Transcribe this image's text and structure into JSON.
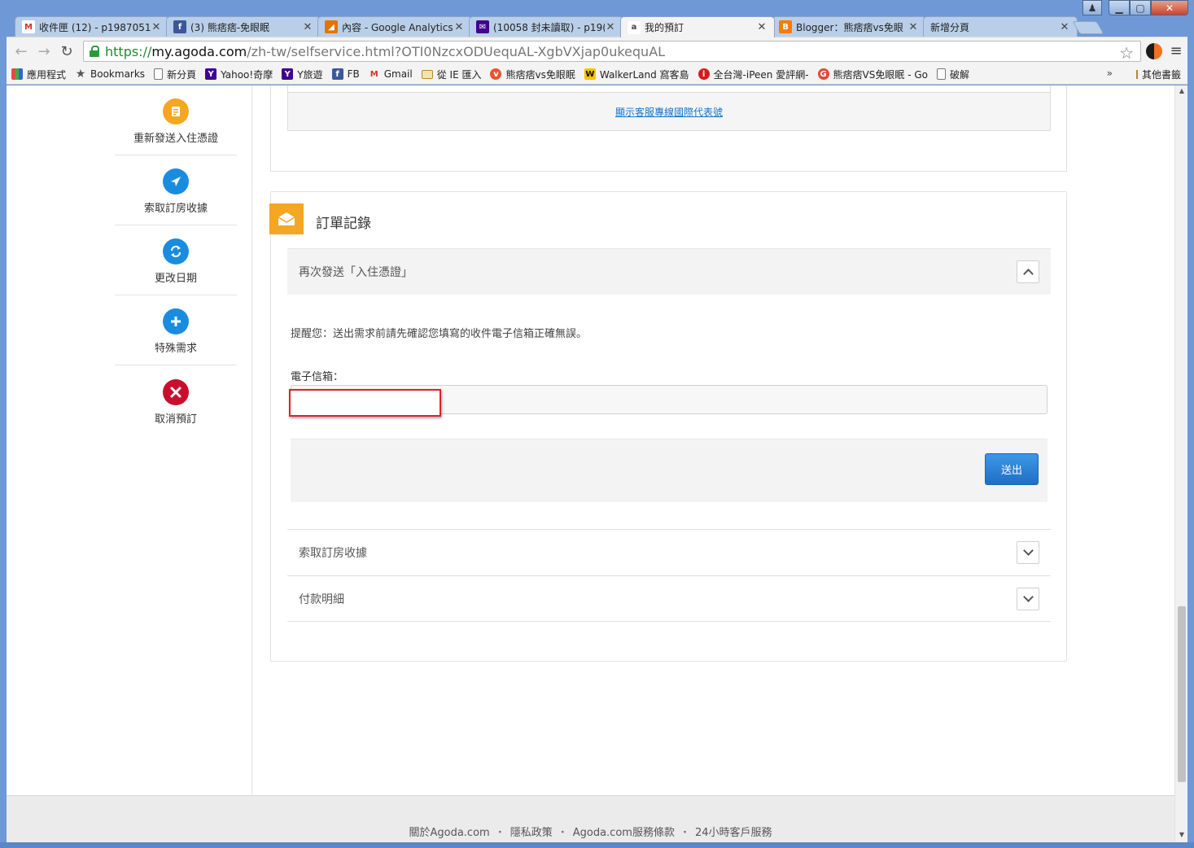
{
  "browser": {
    "tabs": [
      {
        "title": "收件匣 (12) - p1987051",
        "icon": "gmail-icon",
        "color": "#d93025"
      },
      {
        "title": "(3) 熊痞痞-免眼眠",
        "icon": "facebook-icon",
        "color": "#3b5998"
      },
      {
        "title": "內容 - Google Analytics",
        "icon": "analytics-icon",
        "color": "#e37400"
      },
      {
        "title": "(10058 封未讀取) - p19(",
        "icon": "yahoo-mail-icon",
        "color": "#400090"
      },
      {
        "title": "我的預訂",
        "icon": "agoda-icon",
        "color": "#444444"
      },
      {
        "title": "Blogger：熊痞痞vs免眼",
        "icon": "blogger-icon",
        "color": "#f57d00"
      },
      {
        "title": "新增分頁",
        "icon": "",
        "color": ""
      }
    ],
    "url": {
      "scheme": "https://",
      "host": "my.agoda.com",
      "path": "/zh-tw/selfservice.html?OTI0NzcxODUequAL-XgbVXjap0ukequAL"
    },
    "bookmarks": [
      {
        "label": "應用程式",
        "icon": "apps-icon"
      },
      {
        "label": "Bookmarks",
        "icon": "star-icon"
      },
      {
        "label": "新分頁",
        "icon": "page-icon"
      },
      {
        "label": "Yahoo!奇摩",
        "icon": "yahoo-icon"
      },
      {
        "label": "Y旅遊",
        "icon": "yahoo-icon"
      },
      {
        "label": "FB",
        "icon": "facebook-icon"
      },
      {
        "label": "Gmail",
        "icon": "gmail-icon"
      },
      {
        "label": "從 IE 匯入",
        "icon": "folder-icon"
      },
      {
        "label": "熊痞痞vs免眼眠",
        "icon": "blog-icon"
      },
      {
        "label": "WalkerLand 窩客島",
        "icon": "walkerland-icon"
      },
      {
        "label": "全台灣-iPeen 愛評網-",
        "icon": "ipeen-icon"
      },
      {
        "label": "熊痞痞VS免眼眠 - Go",
        "icon": "google-plus-icon"
      },
      {
        "label": "破解",
        "icon": "page-icon"
      }
    ],
    "bookmarks_more": "»",
    "bookmarks_other": "其他書籤"
  },
  "sidebar": {
    "items": [
      {
        "label": "重新發送入住憑證",
        "icon": "voucher-icon",
        "color": "#f5a623"
      },
      {
        "label": "索取訂房收據",
        "icon": "send-icon",
        "color": "#1a8ce0"
      },
      {
        "label": "更改日期",
        "icon": "refresh-icon",
        "color": "#1a8ce0"
      },
      {
        "label": "特殊需求",
        "icon": "plus-icon",
        "color": "#1a8ce0"
      },
      {
        "label": "取消預訂",
        "icon": "cancel-icon",
        "color": "#c8102e"
      }
    ]
  },
  "top_panel": {
    "intl_link": "顯示客服專線國際代表號"
  },
  "order_panel": {
    "title": "訂單記錄",
    "resend": {
      "header": "再次發送「入住憑證」",
      "reminder": "提醒您：送出需求前請先確認您填寫的收件電子信箱正確無誤。",
      "email_label": "電子信箱：",
      "email_value": "",
      "submit_label": "送出"
    },
    "receipt_header": "索取訂房收據",
    "payment_header": "付款明細"
  },
  "footer": {
    "links": [
      "關於Agoda.com",
      "隱私政策",
      "Agoda.com服務條款",
      "24小時客戶服務"
    ],
    "separator": "・"
  },
  "colors": {
    "accent_orange": "#f5a623",
    "primary_blue": "#1f6fc4",
    "highlight_red": "#d9232a"
  }
}
